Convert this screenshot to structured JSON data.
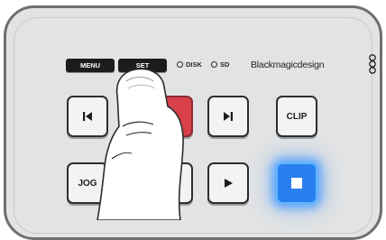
{
  "buttons": {
    "menu": "MENU",
    "set": "SET",
    "clip": "CLIP",
    "jog": "JOG"
  },
  "indicators": {
    "disk": "DISK",
    "sd": "SD"
  },
  "brand": "Blackmagicdesign",
  "icons": {
    "previous": "skip-previous-icon",
    "next": "skip-next-icon",
    "play": "play-icon",
    "stop": "stop-icon",
    "record": "record-button",
    "logo": "blackmagic-logo-icon"
  },
  "colors": {
    "panel": "#e2e3e4",
    "record": "#d9404a",
    "stop_active": "#2a7ff0",
    "glow": "#5db6ff"
  }
}
